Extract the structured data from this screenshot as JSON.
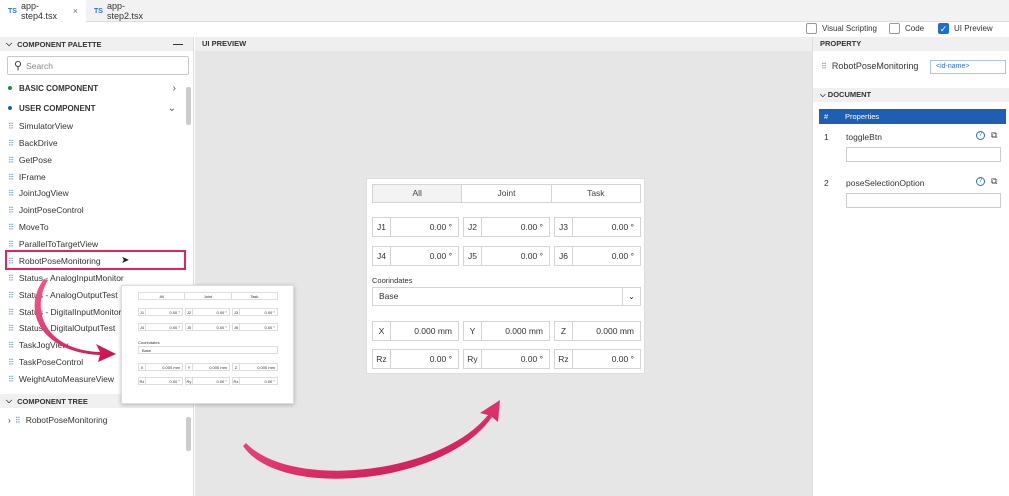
{
  "tabs": [
    {
      "prefix": "TS",
      "label": "app-step4.tsx",
      "close": "×"
    },
    {
      "prefix": "TS",
      "label": "app-step2.tsx"
    }
  ],
  "toolbar": {
    "visual_scripting": "Visual Scripting",
    "code": "Code",
    "ui_preview": "UI Preview"
  },
  "palette": {
    "title": "COMPONENT PALETTE",
    "search_placeholder": "Search",
    "basic_group": "BASIC COMPONENT",
    "user_group": "USER COMPONENT",
    "items": [
      "SimulatorView",
      "BackDrive",
      "GetPose",
      "IFrame",
      "JointJogView",
      "JointPoseControl",
      "MoveTo",
      "ParallelToTargetView",
      "RobotPoseMonitoring",
      "Status - AnalogInputMonitor",
      "Status - AnalogOutputTest",
      "Status - DigitalInputMonitor",
      "Status - DigitalOutputTest",
      "TaskJogView",
      "TaskPoseControl",
      "WeightAutoMeasureView"
    ]
  },
  "tree": {
    "title": "COMPONENT TREE",
    "item": "RobotPoseMonitoring"
  },
  "preview": {
    "title": "UI PREVIEW",
    "segments": [
      "All",
      "Joint",
      "Task"
    ],
    "joints": [
      {
        "label": "J1",
        "value": "0.00 °"
      },
      {
        "label": "J2",
        "value": "0.00 °"
      },
      {
        "label": "J3",
        "value": "0.00 °"
      },
      {
        "label": "J4",
        "value": "0.00 °"
      },
      {
        "label": "J5",
        "value": "0.00 °"
      },
      {
        "label": "J6",
        "value": "0.00 °"
      }
    ],
    "coord_label": "Coorindates",
    "coord_value": "Base",
    "task": [
      {
        "label": "X",
        "value": "0.000 mm"
      },
      {
        "label": "Y",
        "value": "0.000 mm"
      },
      {
        "label": "Z",
        "value": "0.000 mm"
      },
      {
        "label": "Rz",
        "value": "0.00 °"
      },
      {
        "label": "Ry",
        "value": "0.00 °"
      },
      {
        "label": "Rz",
        "value": "0.00 °"
      }
    ]
  },
  "property": {
    "title": "PROPERTY",
    "component_name": "RobotPoseMonitoring",
    "id_placeholder": "<id-name>",
    "document_title": "DOCUMENT",
    "table_headers": [
      "#",
      "Properties"
    ],
    "rows": [
      {
        "num": "1",
        "name": "toggleBtn"
      },
      {
        "num": "2",
        "name": "poseSelectionOption"
      }
    ]
  },
  "colors": {
    "highlight": "#e0245e",
    "accent": "#1e5fb4"
  }
}
